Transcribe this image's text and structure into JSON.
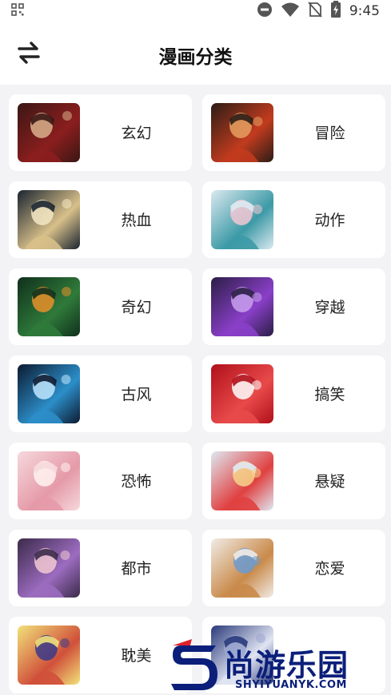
{
  "status_bar": {
    "time": "9:45",
    "icons": [
      "qr-icon",
      "do-not-disturb-icon",
      "wifi-icon",
      "no-sim-icon",
      "battery-charging-icon"
    ]
  },
  "header": {
    "title": "漫画分类",
    "switch_icon": "swap-arrows-icon"
  },
  "categories": [
    {
      "label": "玄幻",
      "thumb_colors": [
        "#3a1714",
        "#8b1e1e",
        "#d9b08c"
      ]
    },
    {
      "label": "冒险",
      "thumb_colors": [
        "#2b1d16",
        "#c23b1e",
        "#e8a060"
      ]
    },
    {
      "label": "热血",
      "thumb_colors": [
        "#1a2430",
        "#d8c08a",
        "#f4e7c4"
      ]
    },
    {
      "label": "动作",
      "thumb_colors": [
        "#dbe9f0",
        "#3c9aa6",
        "#f2c7d4"
      ]
    },
    {
      "label": "奇幻",
      "thumb_colors": [
        "#10301c",
        "#2f7a3a",
        "#e8902a"
      ]
    },
    {
      "label": "穿越",
      "thumb_colors": [
        "#2a1e45",
        "#8a3fc8",
        "#c9a0ee"
      ]
    },
    {
      "label": "古风",
      "thumb_colors": [
        "#0c1a30",
        "#2c8ec9",
        "#bfe8ff"
      ]
    },
    {
      "label": "搞笑",
      "thumb_colors": [
        "#b0101a",
        "#e84a4a",
        "#ffffff"
      ]
    },
    {
      "label": "恐怖",
      "thumb_colors": [
        "#f6d8dc",
        "#e59aa8",
        "#fff3f0"
      ]
    },
    {
      "label": "悬疑",
      "thumb_colors": [
        "#dfe8f2",
        "#e04040",
        "#f6d48a"
      ]
    },
    {
      "label": "都市",
      "thumb_colors": [
        "#3b2a4a",
        "#9c6cc0",
        "#f2c8d4"
      ]
    },
    {
      "label": "恋爱",
      "thumb_colors": [
        "#f1ece6",
        "#c98a4a",
        "#6b9ad0"
      ]
    },
    {
      "label": "耽美",
      "thumb_colors": [
        "#f2e27a",
        "#d0503a",
        "#3a3a8a"
      ]
    },
    {
      "label": "",
      "thumb_colors": [
        "#2a3a7a",
        "#e0e4f2",
        "#9aa6d0"
      ]
    }
  ],
  "watermark": {
    "brand": "尚游乐园",
    "url": "SHYIYUANYK.COM",
    "colors": {
      "primary": "#0b1f7a",
      "accent": "#e0202a"
    }
  }
}
